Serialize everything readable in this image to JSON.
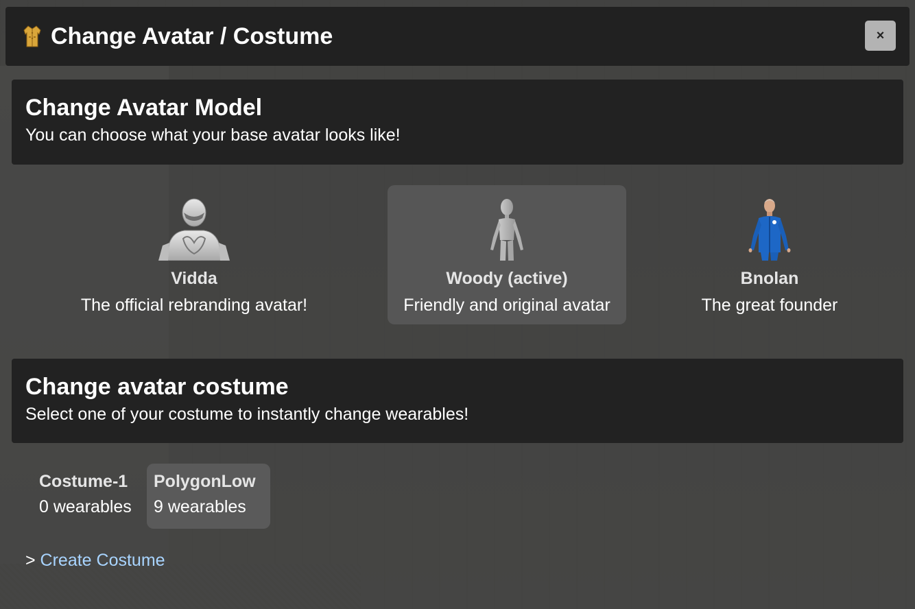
{
  "window": {
    "title": "Change Avatar / Costume",
    "title_icon": "coat-icon",
    "close_label": "×"
  },
  "model_section": {
    "heading": "Change Avatar Model",
    "description": "You can choose what your base avatar looks like!"
  },
  "avatars": [
    {
      "name": "Vidda",
      "description": "The official rebranding avatar!",
      "icon": "vidda-avatar-icon",
      "active": false
    },
    {
      "name": "Woody (active)",
      "description": "Friendly and original avatar",
      "icon": "woody-avatar-icon",
      "active": true
    },
    {
      "name": "Bnolan",
      "description": "The great founder",
      "icon": "bnolan-avatar-icon",
      "active": false
    }
  ],
  "costume_section": {
    "heading": "Change avatar costume",
    "description": "Select one of your costume to instantly change wearables!"
  },
  "costumes": [
    {
      "name": "Costume-1",
      "count": "0 wearables",
      "active": false
    },
    {
      "name": "PolygonLow",
      "count": "9 wearables",
      "active": true
    }
  ],
  "create": {
    "prefix": "> ",
    "link_label": "Create Costume"
  },
  "colors": {
    "link": "#a8d4ff",
    "panel": "#222222",
    "active_card": "#565656"
  }
}
